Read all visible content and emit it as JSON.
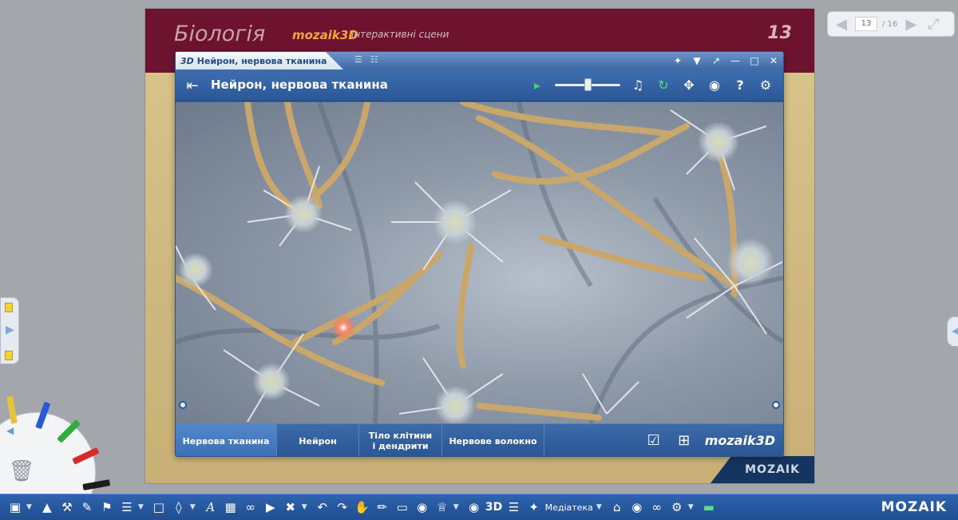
{
  "book": {
    "title": "Біологія",
    "brand": "mozaik3D",
    "subtitle": "інтерактивні сцени",
    "page_number": "13",
    "footer_logo": "MOZAIK"
  },
  "page_nav": {
    "current_page": "13",
    "total_pages": "/ 16"
  },
  "window": {
    "tab_prefix": "3D",
    "tab_title": "Нейрон, нервова тканина",
    "scene_title": "Нейрон, нервова тканина",
    "volume_level": 0.5,
    "tabs": [
      {
        "label": "Нервова тканина",
        "active": true
      },
      {
        "label": "Нейрон",
        "active": false
      },
      {
        "label": "Тіло клітини\nі дендрити",
        "active": false
      },
      {
        "label": "Нервове волокно",
        "active": false
      }
    ],
    "brand": "mozaik3D"
  },
  "toolbar": {
    "media_label": "Медіатека",
    "three_d_label": "3D",
    "brand": "MOZAIK"
  },
  "colors": {
    "window_blue": "#3d6aa8",
    "book_header": "#6d1330",
    "book_brand": "#f2a73d",
    "toolbar_blue": "#2f63ad"
  }
}
